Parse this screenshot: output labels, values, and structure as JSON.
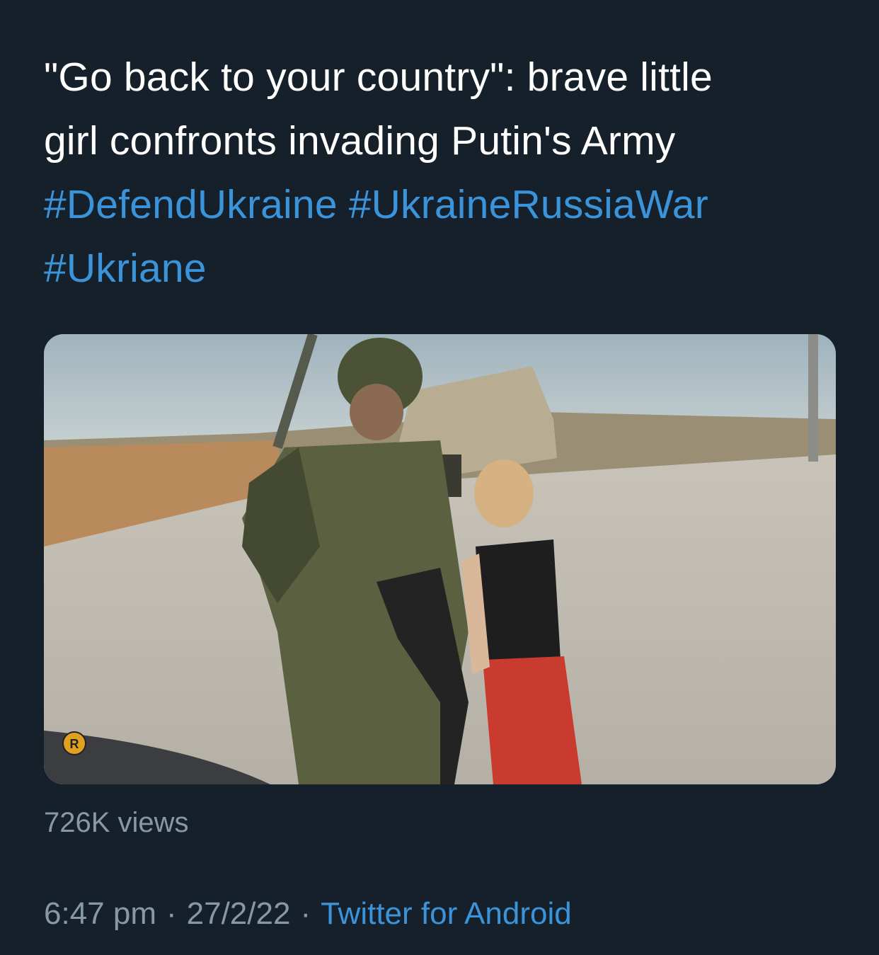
{
  "tweet": {
    "text_line1": "\"Go back to your country\":  brave little",
    "text_line2": "girl confronts invading Putin's Army",
    "hashtags": [
      "#DefendUkraine",
      "#UkraineRussiaWar",
      "#Ukriane"
    ],
    "views": "726K views",
    "time": "6:47 pm",
    "separator": "·",
    "date": "27/2/22",
    "source": "Twitter for Android"
  },
  "media": {
    "watermark_letter": "R"
  },
  "colors": {
    "background": "#15202b",
    "text": "#ffffff",
    "link": "#3b94d9",
    "muted": "#8899a6"
  }
}
